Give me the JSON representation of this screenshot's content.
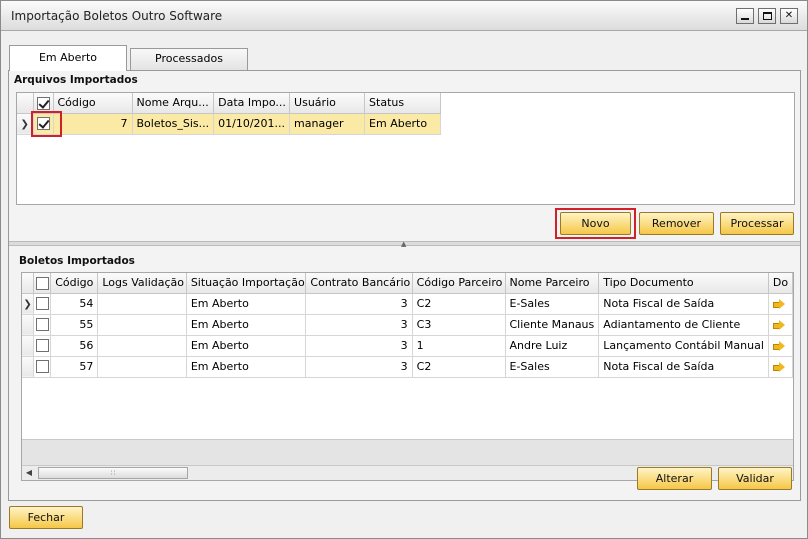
{
  "window": {
    "title": "Importação Boletos Outro Software",
    "minimize_icon": "minimize-icon",
    "maximize_icon": "maximize-icon",
    "close_glyph": "✕"
  },
  "tabs": [
    {
      "label": "Em Aberto",
      "active": true
    },
    {
      "label": "Processados",
      "active": false
    }
  ],
  "arquivos": {
    "section_label": "Arquivos Importados",
    "columns": [
      "Código",
      "Nome Arqu...",
      "Data Impo...",
      "Usuário",
      "Status"
    ],
    "rows": [
      {
        "checked": true,
        "codigo": "7",
        "nome": "Boletos_Sis...",
        "data": "01/10/201...",
        "usuario": "manager",
        "status": "Em Aberto"
      }
    ],
    "buttons": {
      "novo": "Novo",
      "remover": "Remover",
      "processar": "Processar"
    }
  },
  "boletos": {
    "section_label": "Boletos Importados",
    "columns": [
      "Código",
      "Logs Validação",
      "Situação Importação",
      "Contrato Bancário",
      "Código Parceiro",
      "Nome Parceiro",
      "Tipo Documento",
      "Do"
    ],
    "rows": [
      {
        "checked": false,
        "codigo": "54",
        "logs": "",
        "situacao": "Em Aberto",
        "contrato": "3",
        "parceiro": "C2",
        "nome": "E-Sales",
        "tipo": "Nota Fiscal de Saída"
      },
      {
        "checked": false,
        "codigo": "55",
        "logs": "",
        "situacao": "Em Aberto",
        "contrato": "3",
        "parceiro": "C3",
        "nome": "Cliente Manaus",
        "tipo": "Adiantamento de Cliente"
      },
      {
        "checked": false,
        "codigo": "56",
        "logs": "",
        "situacao": "Em Aberto",
        "contrato": "3",
        "parceiro": "1",
        "nome": "Andre Luiz",
        "tipo": "Lançamento Contábil Manual"
      },
      {
        "checked": false,
        "codigo": "57",
        "logs": "",
        "situacao": "Em Aberto",
        "contrato": "3",
        "parceiro": "C2",
        "nome": "E-Sales",
        "tipo": "Nota Fiscal de Saída"
      }
    ],
    "buttons": {
      "alterar": "Alterar",
      "validar": "Validar"
    }
  },
  "footer": {
    "fechar": "Fechar"
  },
  "colors": {
    "highlight_row": "#fbe9a6",
    "button_gold": "#f5c748",
    "red_annotation": "#d0202a"
  }
}
